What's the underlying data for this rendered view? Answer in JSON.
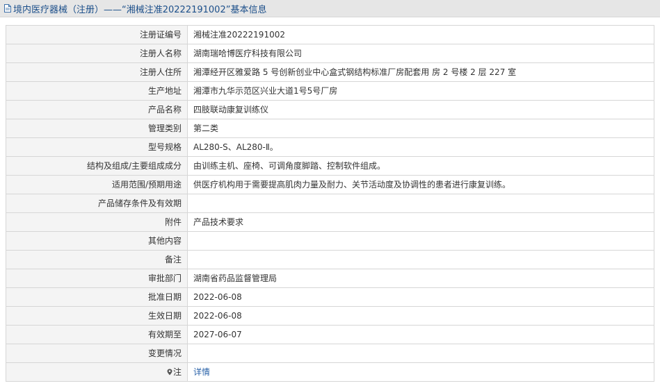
{
  "header": {
    "title": "境内医疗器械（注册）——“湘械注准20222191002”基本信息",
    "icon": "document-icon"
  },
  "rows": [
    {
      "label": "注册证编号",
      "value": "湘械注准20222191002"
    },
    {
      "label": "注册人名称",
      "value": "湖南瑞哈博医疗科技有限公司"
    },
    {
      "label": "注册人住所",
      "value": "湘潭经开区雅爱路 5 号创新创业中心盒式钢结构标准厂房配套用 房 2 号楼 2 层 227 室"
    },
    {
      "label": "生产地址",
      "value": "湘潭市九华示范区兴业大道1号5号厂房"
    },
    {
      "label": "产品名称",
      "value": "四肢联动康复训练仪"
    },
    {
      "label": "管理类别",
      "value": "第二类"
    },
    {
      "label": "型号规格",
      "value": "AL280-S、AL280-Ⅱ。"
    },
    {
      "label": "结构及组成/主要组成成分",
      "value": "由训练主机、座椅、可调角度脚踏、控制软件组成。"
    },
    {
      "label": "适用范围/预期用途",
      "value": "供医疗机构用于需要提高肌肉力量及耐力、关节活动度及协调性的患者进行康复训练。"
    },
    {
      "label": "产品储存条件及有效期",
      "value": ""
    },
    {
      "label": "附件",
      "value": "产品技术要求"
    },
    {
      "label": "其他内容",
      "value": ""
    },
    {
      "label": "备注",
      "value": ""
    },
    {
      "label": "审批部门",
      "value": "湖南省药品监督管理局"
    },
    {
      "label": "批准日期",
      "value": "2022-06-08"
    },
    {
      "label": "生效日期",
      "value": "2022-06-08"
    },
    {
      "label": "有效期至",
      "value": "2027-06-07"
    },
    {
      "label": "变更情况",
      "value": ""
    }
  ],
  "note_row": {
    "label": "注",
    "link_text": "详情",
    "icon": "location-pin-icon"
  },
  "colors": {
    "link": "#2a62a8",
    "title": "#1c4f8a",
    "label_bg": "#f4f4f4",
    "border": "#d6d6d6"
  }
}
